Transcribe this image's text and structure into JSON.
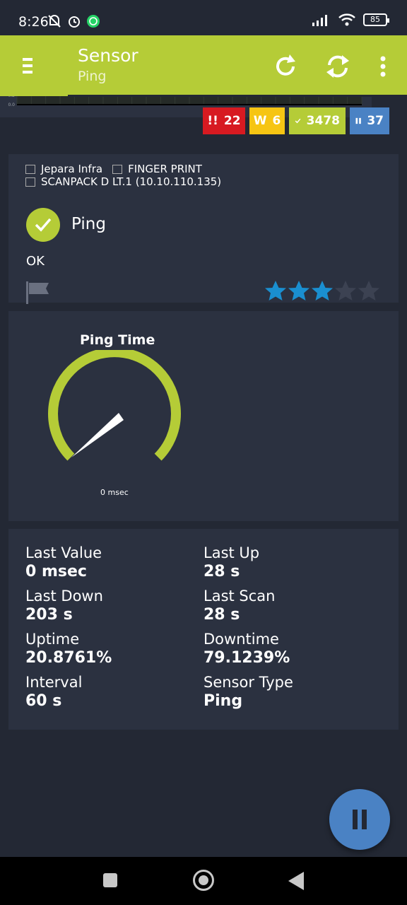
{
  "status_bar": {
    "time": "8:26",
    "battery": "85",
    "icons": [
      "mute-icon",
      "alarm-icon",
      "whatsapp-icon",
      "signal-icon",
      "wifi-icon",
      "battery-icon"
    ]
  },
  "app_bar": {
    "title": "Sensor",
    "subtitle": "Ping",
    "accent_color": "#b5cc37",
    "actions": [
      "refresh-icon",
      "sync-icon",
      "more-vert-icon"
    ]
  },
  "badges": [
    {
      "icon": "!!",
      "count": "22",
      "color": "#d71a21"
    },
    {
      "icon": "W",
      "count": "6",
      "color": "#f6c513"
    },
    {
      "icon": "check",
      "count": "3478",
      "color": "#b5cc37"
    },
    {
      "icon": "pause",
      "count": "37",
      "color": "#4a82c4"
    }
  ],
  "sensor_info": {
    "group": "Jepara Infra",
    "device_group": "FINGER PRINT",
    "device": "SCANPACK D LT.1 (10.10.110.135)",
    "name": "Ping",
    "status": "OK",
    "priority_stars": 3,
    "priority_max": 5
  },
  "gauge": {
    "title": "Ping Time",
    "value": 0,
    "unit_text": "0 msec"
  },
  "stats": {
    "last_value_label": "Last Value",
    "last_value": "0 msec",
    "last_up_label": "Last Up",
    "last_up": "28 s",
    "last_down_label": "Last Down",
    "last_down": "203 s",
    "last_scan_label": "Last Scan",
    "last_scan": "28 s",
    "uptime_label": "Uptime",
    "uptime": "20.8761%",
    "downtime_label": "Downtime",
    "downtime": "79.1239%",
    "interval_label": "Interval",
    "interval": "60 s",
    "sensor_type_label": "Sensor Type",
    "sensor_type": "Ping"
  },
  "chart_data": {
    "type": "line",
    "y_ticks": [
      "0.0",
      "0.2",
      "0.4",
      "0.6",
      "0.8",
      "1.0",
      "1.2",
      "1.4",
      "1.6",
      "1.8",
      "2.0"
    ],
    "ylim": [
      0,
      2.0
    ],
    "grid": true
  }
}
